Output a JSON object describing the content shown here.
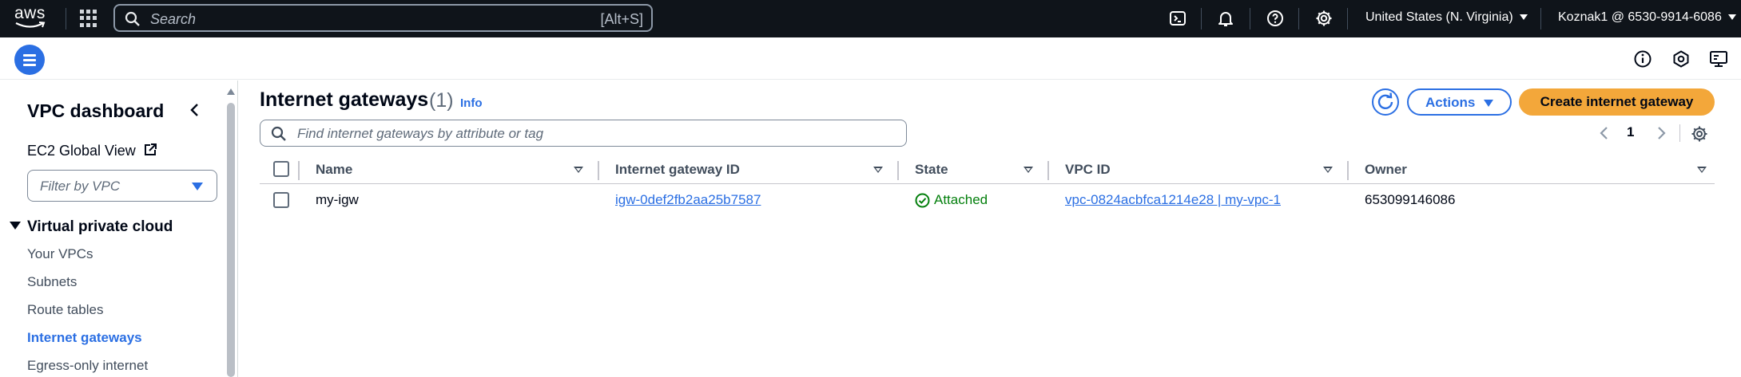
{
  "topnav": {
    "logo_text": "aws",
    "search_placeholder": "Search",
    "search_shortcut": "[Alt+S]",
    "region": "United States (N. Virginia)",
    "account": "Koznak1 @ 6530-9914-6086",
    "icons": [
      "cloudshell-icon",
      "bell-icon",
      "help-icon",
      "settings-icon"
    ]
  },
  "subbar": {
    "icons": [
      "info-icon",
      "notifications-settings-icon",
      "console-display-icon"
    ]
  },
  "sidebar": {
    "title": "VPC dashboard",
    "ec2_global_view": "EC2 Global View",
    "filter_placeholder": "Filter by VPC",
    "section": "Virtual private cloud",
    "items": [
      {
        "label": "Your VPCs",
        "active": false
      },
      {
        "label": "Subnets",
        "active": false
      },
      {
        "label": "Route tables",
        "active": false
      },
      {
        "label": "Internet gateways",
        "active": true
      },
      {
        "label": "Egress-only internet",
        "active": false
      }
    ]
  },
  "main": {
    "title": "Internet gateways",
    "count": "(1)",
    "info": "Info",
    "actions_label": "Actions",
    "create_label": "Create internet gateway",
    "filter_placeholder": "Find internet gateways by attribute or tag",
    "page": "1",
    "columns": [
      "Name",
      "Internet gateway ID",
      "State",
      "VPC ID",
      "Owner"
    ],
    "rows": [
      {
        "name": "my-igw",
        "gateway_id": "igw-0def2fb2aa25b7587",
        "state": "Attached",
        "vpc_id": "vpc-0824acbfca1214e28 | my-vpc-1",
        "owner": "653099146086"
      }
    ]
  },
  "colors": {
    "nav_bg": "#0f141a",
    "link_blue": "#2b6fe3",
    "primary_orange": "#f3a73a",
    "success_green": "#037f0c"
  }
}
